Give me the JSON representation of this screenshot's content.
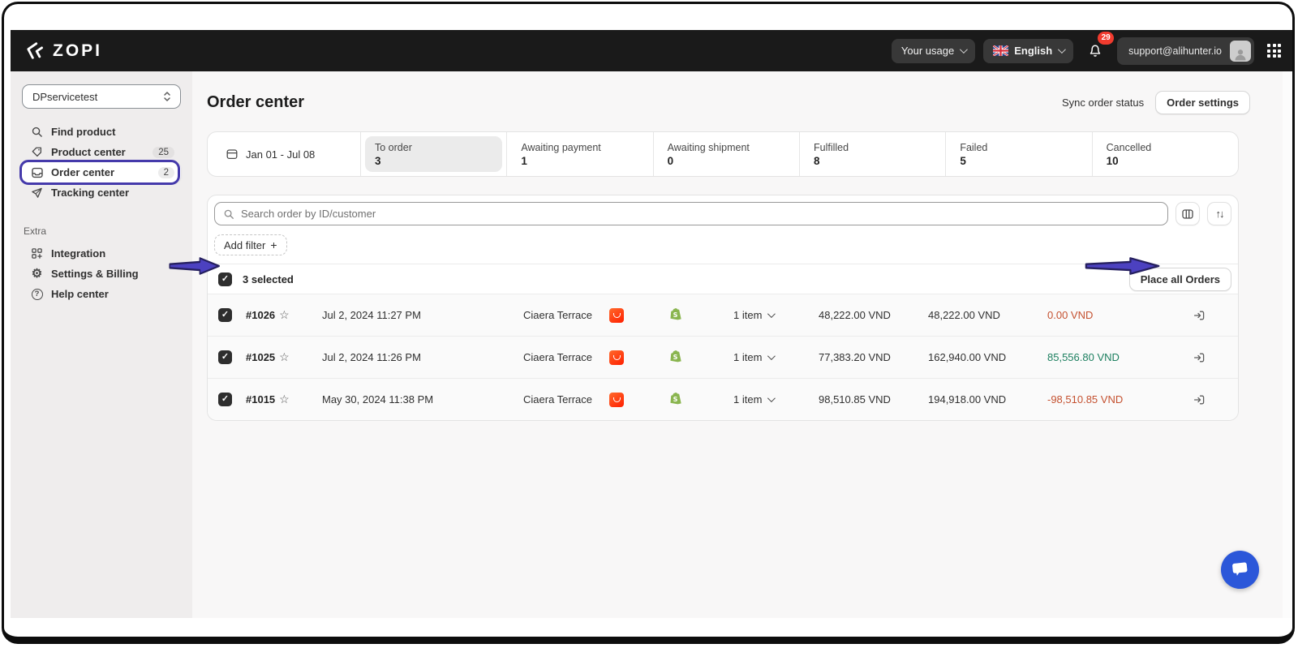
{
  "topbar": {
    "brand": "ZOPI",
    "usage_label": "Your usage",
    "language_label": "English",
    "notification_count": "29",
    "account_email": "support@alihunter.io"
  },
  "sidebar": {
    "store_selector": "DPservicetest",
    "items": [
      {
        "label": "Find product"
      },
      {
        "label": "Product center",
        "badge": "25"
      },
      {
        "label": "Order center",
        "badge": "2"
      },
      {
        "label": "Tracking center"
      }
    ],
    "extra_label": "Extra",
    "extra_items": [
      {
        "label": "Integration"
      },
      {
        "label": "Settings & Billing"
      },
      {
        "label": "Help center"
      }
    ]
  },
  "header": {
    "title": "Order center",
    "sync_label": "Sync order status",
    "settings_button": "Order settings"
  },
  "filters": {
    "date_range": "Jan 01 - Jul 08",
    "tabs": [
      {
        "label": "To order",
        "count": "3"
      },
      {
        "label": "Awaiting payment",
        "count": "1"
      },
      {
        "label": "Awaiting shipment",
        "count": "0"
      },
      {
        "label": "Fulfilled",
        "count": "8"
      },
      {
        "label": "Failed",
        "count": "5"
      },
      {
        "label": "Cancelled",
        "count": "10"
      }
    ]
  },
  "table": {
    "search_placeholder": "Search order by ID/customer",
    "add_filter_label": "Add filter",
    "selected_text": "3 selected",
    "place_all_label": "Place all Orders",
    "rows": [
      {
        "id": "#1026",
        "date": "Jul 2, 2024 11:27 PM",
        "customer": "Ciaera Terrace",
        "items": "1 item",
        "cost": "48,222.00 VND",
        "total": "48,222.00 VND",
        "profit": "0.00 VND",
        "profit_state": "negative"
      },
      {
        "id": "#1025",
        "date": "Jul 2, 2024 11:26 PM",
        "customer": "Ciaera Terrace",
        "items": "1 item",
        "cost": "77,383.20 VND",
        "total": "162,940.00 VND",
        "profit": "85,556.80 VND",
        "profit_state": "positive"
      },
      {
        "id": "#1015",
        "date": "May 30, 2024 11:38 PM",
        "customer": "Ciaera Terrace",
        "items": "1 item",
        "cost": "98,510.85 VND",
        "total": "194,918.00 VND",
        "profit": "-98,510.85 VND",
        "profit_state": "negative"
      }
    ]
  },
  "icons": {
    "check": "✓",
    "star": "☆",
    "sort": "↑↓",
    "plus": "+",
    "gear": "⚙",
    "question": "?"
  },
  "colors": {
    "topbar_bg": "#1a1a1a",
    "sidebar_bg": "#efeded",
    "profit_positive": "#1c7f5f",
    "profit_negative": "#c4502f",
    "annotation_purple": "#453aab",
    "notification_red": "#f13b2e",
    "chat_blue": "#2b57d9",
    "aliexpress_red": "#ff2d00",
    "shopify_green": "#8ab54f"
  }
}
